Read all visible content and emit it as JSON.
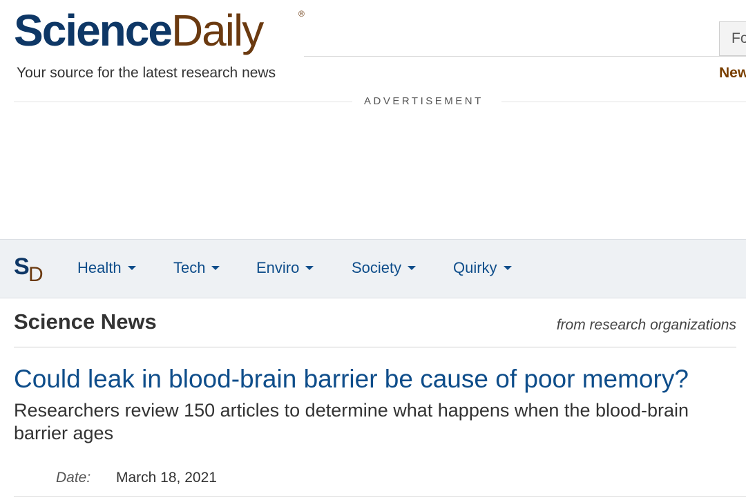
{
  "header": {
    "logo_part1": "Science",
    "logo_part2": "Daily",
    "registered_mark": "®",
    "tagline": "Your source for the latest research news",
    "search_partial": "Fo",
    "news_link_partial": "New"
  },
  "advertisement": {
    "label": "ADVERTISEMENT"
  },
  "nav": {
    "logo_s": "S",
    "logo_d": "D",
    "items": [
      {
        "label": "Health"
      },
      {
        "label": "Tech"
      },
      {
        "label": "Enviro"
      },
      {
        "label": "Society"
      },
      {
        "label": "Quirky"
      }
    ]
  },
  "section": {
    "title": "Science News",
    "subtitle": "from research organizations"
  },
  "article": {
    "headline": "Could leak in blood-brain barrier be cause of poor memory?",
    "subheadline": "Researchers review 150 articles to determine what happens when the blood-brain barrier ages",
    "date_label": "Date:",
    "date_value": "March 18, 2021"
  },
  "colors": {
    "brand_blue": "#0e3766",
    "brand_brown": "#6b3a10",
    "link_blue": "#0e4d8a",
    "nav_bg": "#eef1f4"
  }
}
